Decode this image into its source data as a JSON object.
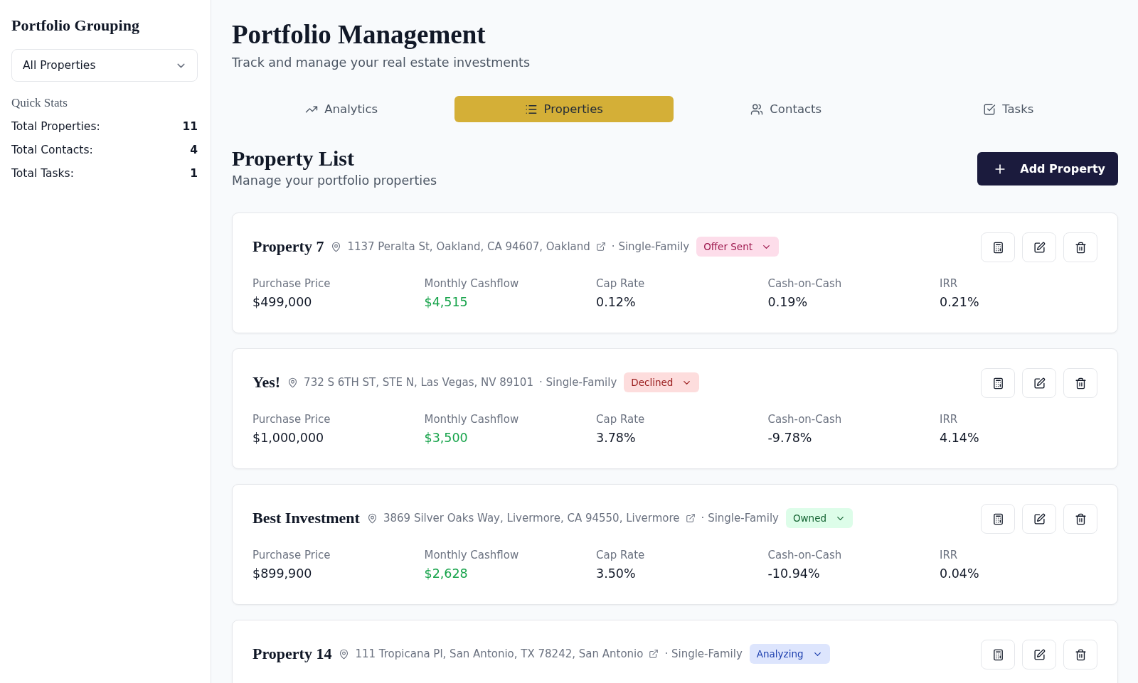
{
  "sidebar": {
    "title": "Portfolio Grouping",
    "grouping_select": {
      "value": "All Properties"
    },
    "quick_stats": {
      "title": "Quick Stats",
      "rows": [
        {
          "label": "Total Properties:",
          "value": "11"
        },
        {
          "label": "Total Contacts:",
          "value": "4"
        },
        {
          "label": "Total Tasks:",
          "value": "1"
        }
      ]
    }
  },
  "header": {
    "title": "Portfolio Management",
    "subtitle": "Track and manage your real estate investments"
  },
  "tabs": [
    {
      "label": "Analytics",
      "selected": false
    },
    {
      "label": "Properties",
      "selected": true
    },
    {
      "label": "Contacts",
      "selected": false
    },
    {
      "label": "Tasks",
      "selected": false
    }
  ],
  "property_list": {
    "title": "Property List",
    "subtitle": "Manage your portfolio properties",
    "add_button": "Add Property",
    "properties": [
      {
        "name": "Property 7",
        "address": "1137 Peralta St, Oakland, CA 94607, Oakland",
        "external_link": true,
        "type": "· Single-Family",
        "status": {
          "label": "Offer Sent",
          "color": "#9d174d"
        },
        "metrics": [
          {
            "label": "Purchase Price",
            "value": "$499,000",
            "kind": "plain"
          },
          {
            "label": "Monthly Cashflow",
            "value": "$4,515",
            "kind": "gain"
          },
          {
            "label": "Cap Rate",
            "value": "0.12%",
            "kind": "plain"
          },
          {
            "label": "Cash-on-Cash",
            "value": "0.19%",
            "kind": "plain"
          },
          {
            "label": "IRR",
            "value": "0.21%",
            "kind": "plain"
          }
        ]
      },
      {
        "name": "Yes!",
        "address": "732 S 6TH ST, STE N, Las Vegas, NV 89101",
        "external_link": false,
        "type": "· Single-Family",
        "status": {
          "label": "Declined",
          "color": "#991b1b"
        },
        "metrics": [
          {
            "label": "Purchase Price",
            "value": "$1,000,000",
            "kind": "plain"
          },
          {
            "label": "Monthly Cashflow",
            "value": "$3,500",
            "kind": "gain"
          },
          {
            "label": "Cap Rate",
            "value": "3.78%",
            "kind": "plain"
          },
          {
            "label": "Cash-on-Cash",
            "value": "-9.78%",
            "kind": "plain"
          },
          {
            "label": "IRR",
            "value": "4.14%",
            "kind": "plain"
          }
        ]
      },
      {
        "name": "Best Investment",
        "address": "3869 Silver Oaks Way, Livermore, CA 94550, Livermore",
        "external_link": true,
        "type": "· Single-Family",
        "status": {
          "label": "Owned",
          "color": "#166534"
        },
        "metrics": [
          {
            "label": "Purchase Price",
            "value": "$899,900",
            "kind": "plain"
          },
          {
            "label": "Monthly Cashflow",
            "value": "$2,628",
            "kind": "gain"
          },
          {
            "label": "Cap Rate",
            "value": "3.50%",
            "kind": "plain"
          },
          {
            "label": "Cash-on-Cash",
            "value": "-10.94%",
            "kind": "plain"
          },
          {
            "label": "IRR",
            "value": "0.04%",
            "kind": "plain"
          }
        ]
      },
      {
        "name": "Property 14",
        "address": "111 Tropicana Pl, San Antonio, TX 78242, San Antonio",
        "external_link": true,
        "type": "· Single-Family",
        "status": {
          "label": "Analyzing",
          "color": "#1e40af"
        }
      }
    ]
  }
}
